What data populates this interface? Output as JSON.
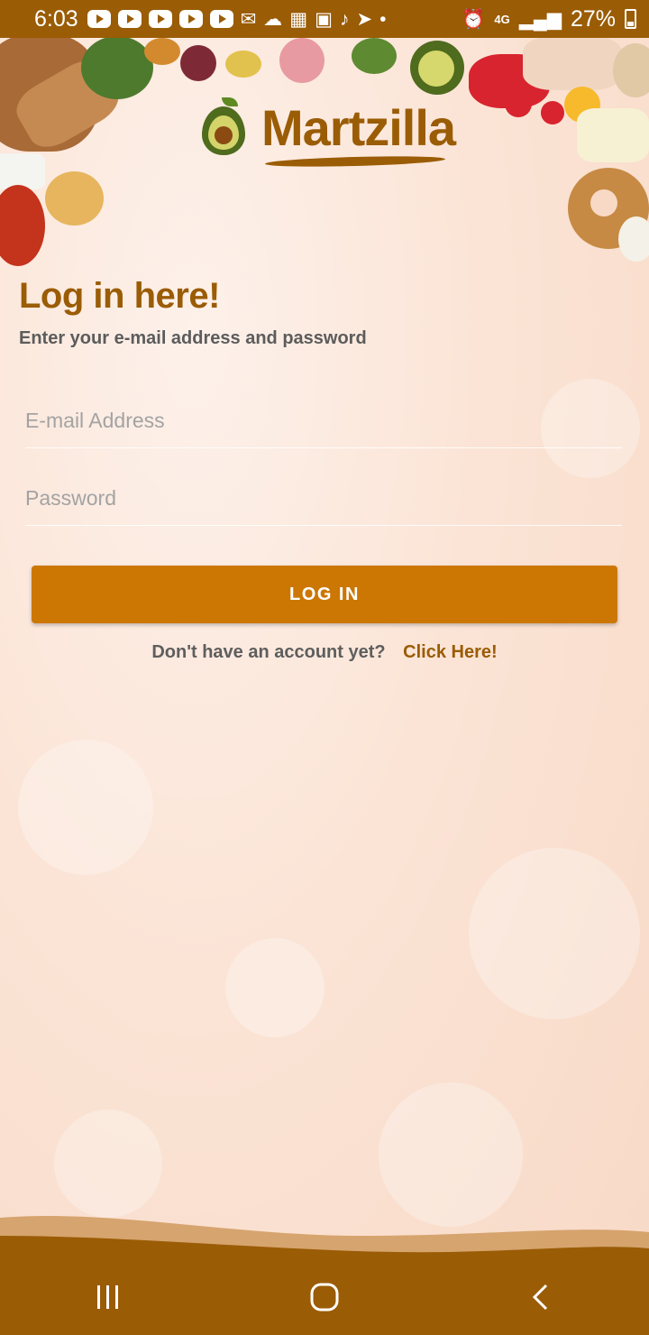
{
  "status_bar": {
    "time": "6:03",
    "network": "4G",
    "battery": "27%"
  },
  "brand": {
    "name": "Martzilla",
    "color": "#9a5c05"
  },
  "login": {
    "title": "Log in here!",
    "subtitle": "Enter your e-mail address and password",
    "email_placeholder": "E-mail Address",
    "password_placeholder": "Password",
    "button_label": "LOG IN",
    "button_color": "#cc7703",
    "signup_prompt": "Don't have an account yet?",
    "signup_link": "Click Here!"
  },
  "nav_bar": {
    "icons": [
      "recent-apps-icon",
      "home-icon",
      "back-icon"
    ]
  }
}
